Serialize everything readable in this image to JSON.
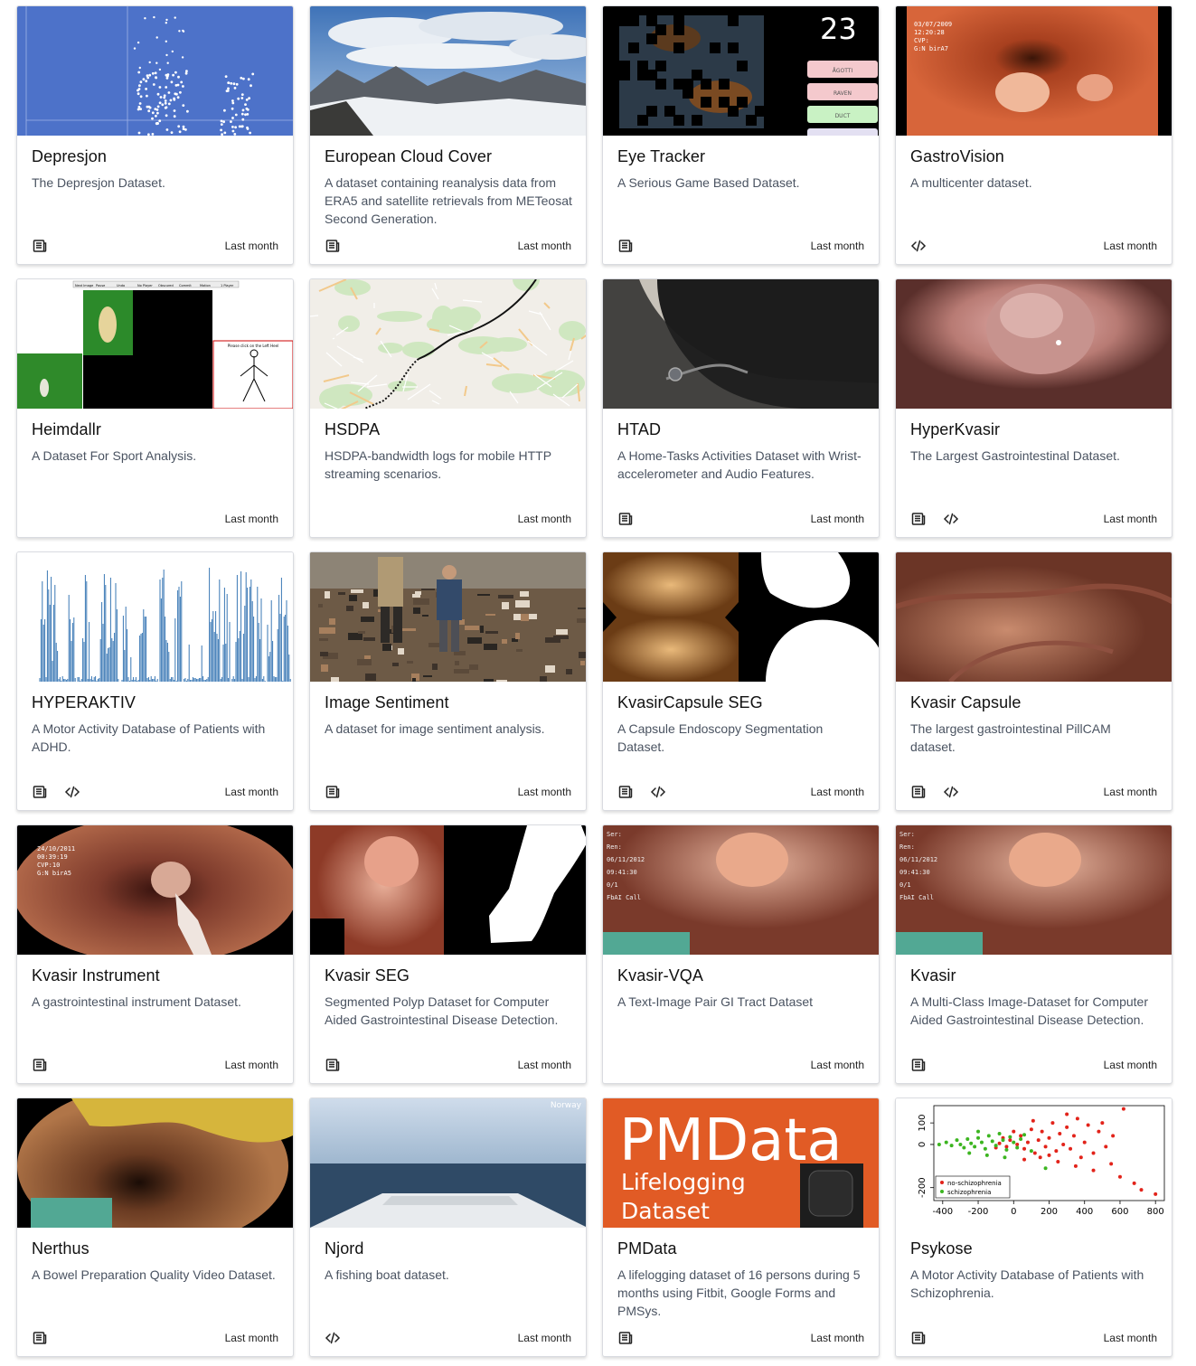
{
  "datasets": [
    {
      "title": "Depresjon",
      "description": "The Depresjon Dataset.",
      "date": "Last month",
      "links": [
        "paper"
      ],
      "thumb": "scatter-blue"
    },
    {
      "title": "European Cloud Cover",
      "description": "A dataset containing reanalysis data from ERA5 and satellite retrievals from METeosat Second Generation.",
      "date": "Last month",
      "links": [
        "paper"
      ],
      "thumb": "mountains"
    },
    {
      "title": "Eye Tracker",
      "description": "A Serious Game Based Dataset.",
      "date": "Last month",
      "links": [
        "paper"
      ],
      "thumb": "game",
      "thumb_text": {
        "counter": "23",
        "buttons": [
          "ÅGOTTI",
          "RAVEN",
          "DUCT",
          ""
        ]
      }
    },
    {
      "title": "GastroVision",
      "description": "A multicenter dataset.",
      "date": "Last month",
      "links": [
        "code"
      ],
      "thumb": "endoscopy-orange",
      "thumb_text": {
        "overlay": [
          "03/07/2009",
          "12:20:28",
          "CVP:",
          "G:N    birA7"
        ]
      }
    },
    {
      "title": "Heimdallr",
      "description": "A Dataset For Sport Analysis.",
      "date": "Last month",
      "links": [],
      "thumb": "sport",
      "thumb_text": {
        "toolbar": [
          "Next Image",
          "Pause",
          "Undo",
          "No Player",
          "Obscured",
          "Commit",
          "Motion",
          "1 Player"
        ],
        "prompt": "Please click on the Left Heel"
      }
    },
    {
      "title": "HSDPA",
      "description": "HSDPA-bandwidth logs for mobile HTTP streaming scenarios.",
      "date": "Last month",
      "links": [],
      "thumb": "map"
    },
    {
      "title": "HTAD",
      "description": "A Home-Tasks Activities Dataset with Wrist-accelerometer and Audio Features.",
      "date": "Last month",
      "links": [
        "paper"
      ],
      "thumb": "watch"
    },
    {
      "title": "HyperKvasir",
      "description": "The Largest Gastrointestinal Dataset.",
      "date": "Last month",
      "links": [
        "paper",
        "code"
      ],
      "thumb": "polyp-pink"
    },
    {
      "title": "HYPERAKTIV",
      "description": "A Motor Activity Database of Patients with ADHD.",
      "date": "Last month",
      "links": [
        "paper",
        "code"
      ],
      "thumb": "activity"
    },
    {
      "title": "Image Sentiment",
      "description": "A dataset for image sentiment analysis.",
      "date": "Last month",
      "links": [
        "paper"
      ],
      "thumb": "fire"
    },
    {
      "title": "KvasirCapsule SEG",
      "description": "A Capsule Endoscopy Segmentation Dataset.",
      "date": "Last month",
      "links": [
        "paper",
        "code"
      ],
      "thumb": "capsule-seg"
    },
    {
      "title": "Kvasir Capsule",
      "description": "The largest gastrointestinal PillCAM dataset.",
      "date": "Last month",
      "links": [
        "paper",
        "code"
      ],
      "thumb": "capsule"
    },
    {
      "title": "Kvasir Instrument",
      "description": "A gastrointestinal instrument Dataset.",
      "date": "Last month",
      "links": [
        "paper"
      ],
      "thumb": "instrument",
      "thumb_text": {
        "overlay": [
          "24/10/2011",
          "00:39:19",
          "CVP:10",
          "G:N    birA5"
        ]
      }
    },
    {
      "title": "Kvasir SEG",
      "description": "Segmented Polyp Dataset for Computer Aided Gastrointestinal Disease Detection.",
      "date": "Last month",
      "links": [
        "paper"
      ],
      "thumb": "polyp-seg"
    },
    {
      "title": "Kvasir-VQA",
      "description": "A Text-Image Pair GI Tract Dataset",
      "date": "Last month",
      "links": [],
      "thumb": "polyp-green",
      "thumb_text": {
        "overlay": [
          "Ser:",
          "Ren:",
          "06/11/2012",
          "09:41:30",
          "0/1",
          "FbAI Call"
        ]
      }
    },
    {
      "title": "Kvasir",
      "description": "A Multi-Class Image-Dataset for Computer Aided Gastrointestinal Disease Detection.",
      "date": "Last month",
      "links": [
        "paper"
      ],
      "thumb": "polyp-green",
      "thumb_text": {
        "overlay": [
          "Ser:",
          "Ren:",
          "06/11/2012",
          "09:41:30",
          "0/1",
          "FbAI Call"
        ]
      }
    },
    {
      "title": "Nerthus",
      "description": "A Bowel Preparation Quality Video Dataset.",
      "date": "Last month",
      "links": [
        "paper"
      ],
      "thumb": "bowel"
    },
    {
      "title": "Njord",
      "description": "A fishing boat dataset.",
      "date": "Last month",
      "links": [
        "code"
      ],
      "thumb": "boat",
      "thumb_text": {
        "corner": "Norway"
      }
    },
    {
      "title": "PMData",
      "description": "A lifelogging dataset of 16 persons during 5 months using Fitbit, Google Forms and PMSys.",
      "date": "Last month",
      "links": [
        "paper"
      ],
      "thumb": "pmdata",
      "thumb_text": {
        "big": "PMData",
        "line1": "Lifelogging",
        "line2": "Dataset"
      }
    },
    {
      "title": "Psykose",
      "description": "A Motor Activity Database of Patients with Schizophrenia.",
      "date": "Last month",
      "links": [
        "paper"
      ],
      "thumb": "psykose",
      "chart_data": {
        "type": "scatter",
        "title": "",
        "xlabel": "",
        "ylabel": "",
        "xlim": [
          -450,
          850
        ],
        "ylim": [
          -260,
          180
        ],
        "xticks": [
          "-400",
          "-200",
          "0",
          "200",
          "400",
          "600",
          "800"
        ],
        "yticks": [
          "-200",
          "0",
          "100"
        ],
        "legend": "bottom-left",
        "series": [
          {
            "name": "no-schizophrenia",
            "color": "#e2231a",
            "points": [
              [
                620,
                165
              ],
              [
                720,
                -210
              ],
              [
                800,
                -230
              ],
              [
                680,
                -180
              ],
              [
                560,
                40
              ],
              [
                520,
                -10
              ],
              [
                480,
                60
              ],
              [
                450,
                -40
              ],
              [
                420,
                90
              ],
              [
                400,
                10
              ],
              [
                380,
                -60
              ],
              [
                360,
                120
              ],
              [
                340,
                40
              ],
              [
                320,
                -20
              ],
              [
                300,
                80
              ],
              [
                280,
                0
              ],
              [
                260,
                50
              ],
              [
                240,
                -30
              ],
              [
                220,
                100
              ],
              [
                200,
                30
              ],
              [
                180,
                -10
              ],
              [
                160,
                60
              ],
              [
                140,
                20
              ],
              [
                120,
                -40
              ],
              [
                100,
                70
              ],
              [
                80,
                10
              ],
              [
                60,
                -20
              ],
              [
                40,
                40
              ],
              [
                20,
                0
              ],
              [
                0,
                60
              ],
              [
                -20,
                20
              ],
              [
                -40,
                -10
              ],
              [
                -60,
                30
              ],
              [
                -80,
                5
              ],
              [
                -100,
                -15
              ],
              [
                150,
                -60
              ],
              [
                250,
                -80
              ],
              [
                350,
                -100
              ],
              [
                450,
                -120
              ],
              [
                550,
                -90
              ],
              [
                600,
                -150
              ],
              [
                300,
                140
              ],
              [
                200,
                -50
              ],
              [
                110,
                110
              ],
              [
                60,
                -70
              ],
              [
                500,
                100
              ]
            ]
          },
          {
            "name": "schizophrenia",
            "color": "#3cb520",
            "points": [
              [
                -420,
                0
              ],
              [
                -380,
                10
              ],
              [
                -350,
                -5
              ],
              [
                -320,
                20
              ],
              [
                -300,
                0
              ],
              [
                -280,
                -15
              ],
              [
                -260,
                25
              ],
              [
                -240,
                5
              ],
              [
                -220,
                -10
              ],
              [
                -200,
                30
              ],
              [
                -180,
                10
              ],
              [
                -160,
                -20
              ],
              [
                -140,
                40
              ],
              [
                -120,
                15
              ],
              [
                -100,
                -5
              ],
              [
                -80,
                50
              ],
              [
                -60,
                20
              ],
              [
                -40,
                -25
              ],
              [
                -20,
                35
              ],
              [
                0,
                10
              ],
              [
                20,
                -15
              ],
              [
                40,
                25
              ],
              [
                60,
                45
              ],
              [
                -250,
                -40
              ],
              [
                -150,
                -50
              ],
              [
                -50,
                -60
              ],
              [
                100,
                -30
              ],
              [
                -200,
                60
              ],
              [
                180,
                -110
              ]
            ]
          }
        ]
      }
    }
  ],
  "icons": {
    "paper": "paper-icon",
    "code": "code-icon"
  }
}
